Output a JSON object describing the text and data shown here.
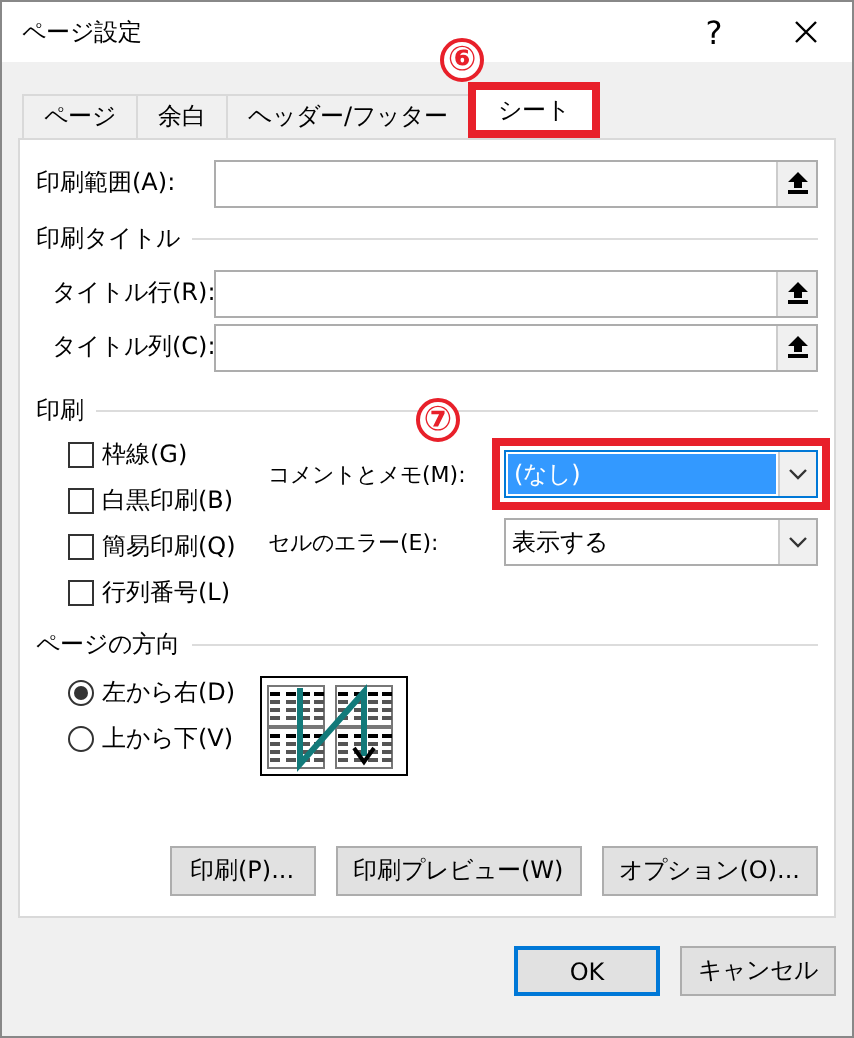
{
  "window": {
    "title": "ページ設定",
    "help": "?"
  },
  "tabs": [
    {
      "label": "ページ",
      "selected": false
    },
    {
      "label": "余白",
      "selected": false
    },
    {
      "label": "ヘッダー/フッター",
      "selected": false
    },
    {
      "label": "シート",
      "selected": true,
      "callout": "⑥"
    }
  ],
  "print_area": {
    "label": "印刷範囲(A):"
  },
  "print_titles": {
    "heading": "印刷タイトル",
    "fields": [
      {
        "label": "タイトル行(R):"
      },
      {
        "label": "タイトル列(C):"
      }
    ]
  },
  "print": {
    "heading": "印刷",
    "checkboxes": [
      {
        "label": "枠線(G)",
        "checked": false
      },
      {
        "label": "白黒印刷(B)",
        "checked": false
      },
      {
        "label": "簡易印刷(Q)",
        "checked": false
      },
      {
        "label": "行列番号(L)",
        "checked": false
      }
    ],
    "dropdowns": [
      {
        "label": "コメントとメモ(M):",
        "value": "(なし)",
        "focused": true,
        "callout": "⑦"
      },
      {
        "label": "セルのエラー(E):",
        "value": "表示する",
        "focused": false
      }
    ]
  },
  "page_order": {
    "heading": "ページの方向",
    "options": [
      {
        "label": "左から右(D)",
        "selected": true
      },
      {
        "label": "上から下(V)",
        "selected": false
      }
    ]
  },
  "panel_buttons": [
    "印刷(P)...",
    "印刷プレビュー(W)",
    "オプション(O)..."
  ],
  "dialog_buttons": [
    {
      "label": "OK",
      "default": true
    },
    {
      "label": "キャンセル",
      "default": false
    }
  ]
}
